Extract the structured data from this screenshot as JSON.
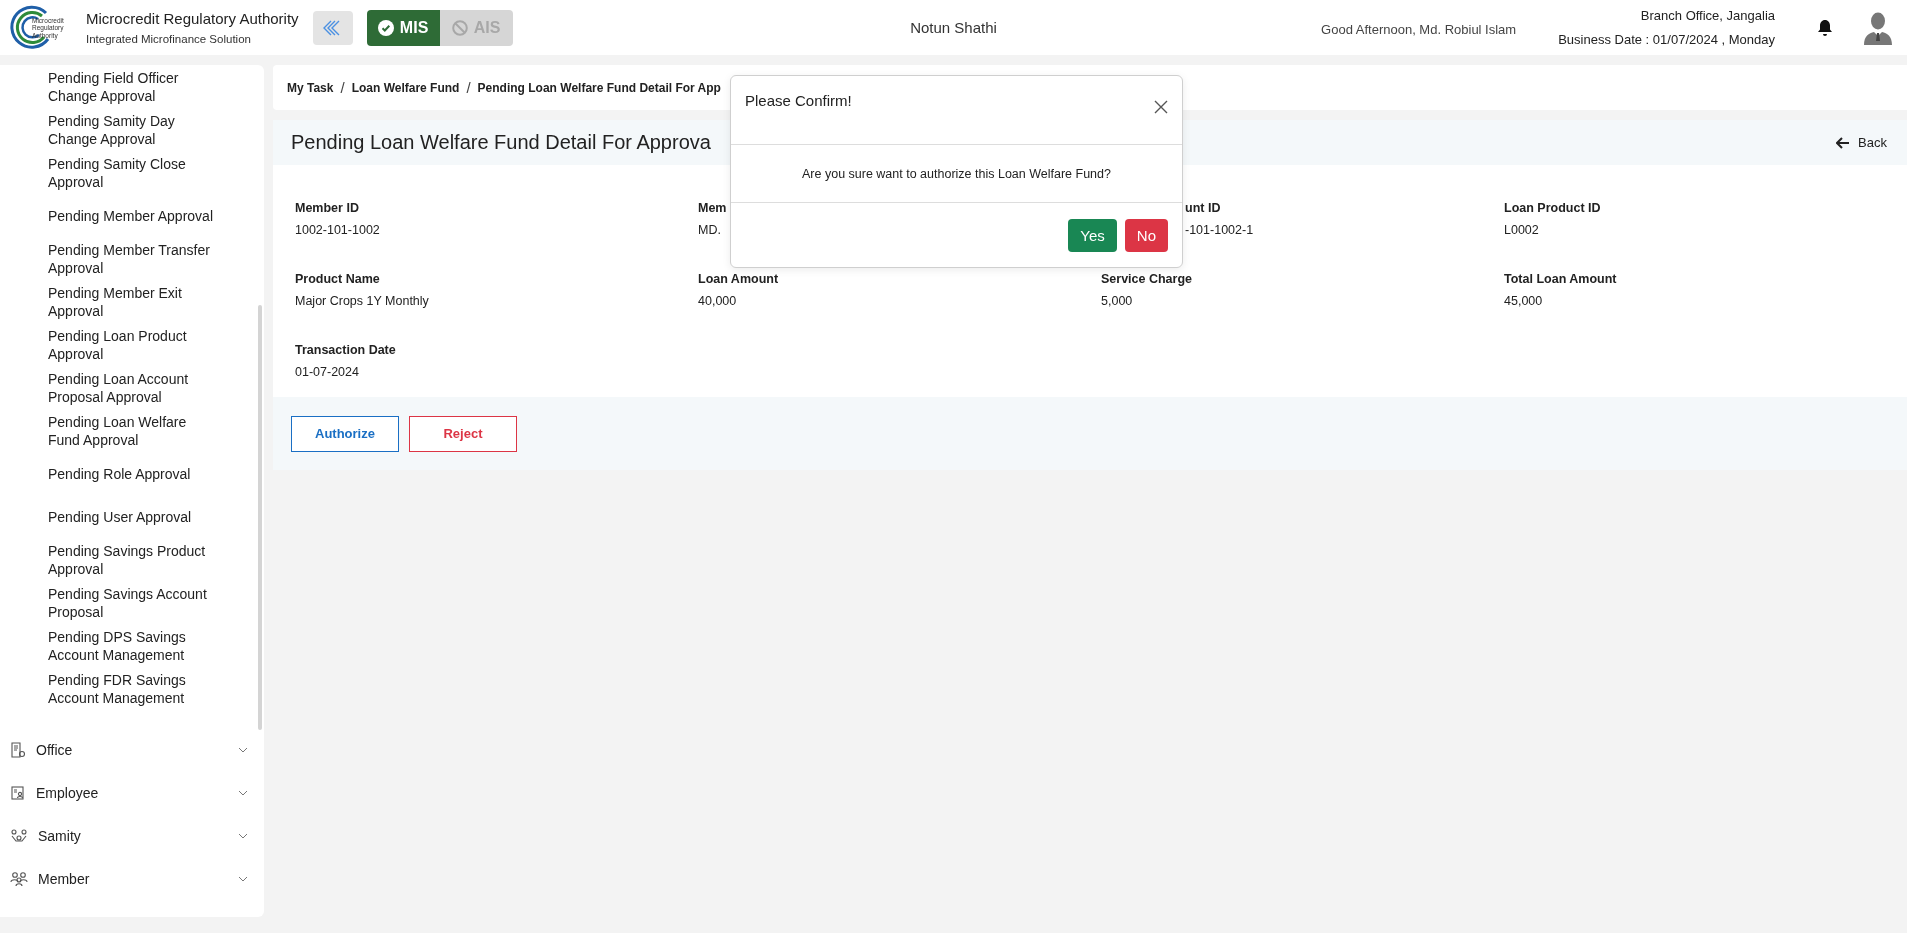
{
  "header": {
    "logo_text": "Microcredit Regulatory Authority",
    "org_title": "Microcredit Regulatory Authority",
    "org_subtitle": "Integrated Microfinance Solution",
    "modules": [
      {
        "label": "MIS",
        "selected": true
      },
      {
        "label": "AIS",
        "selected": false
      }
    ],
    "app_name": "Notun Shathi",
    "greeting": "Good Afternoon, Md. Robiul Islam",
    "branch": "Branch Office, Jangalia",
    "business_date": "Business Date : 01/07/2024 , Monday"
  },
  "sidebar": {
    "items": [
      {
        "label": "Pending Field Officer Change Approval"
      },
      {
        "label": "Pending Samity Day Change Approval"
      },
      {
        "label": "Pending Samity Close Approval"
      },
      {
        "label": "Pending Member Approval"
      },
      {
        "label": "Pending Member Transfer Approval"
      },
      {
        "label": "Pending Member Exit Approval"
      },
      {
        "label": "Pending Loan Product Approval"
      },
      {
        "label": "Pending Loan Account Proposal Approval"
      },
      {
        "label": "Pending Loan Welfare Fund Approval"
      },
      {
        "label": "Pending Role Approval"
      },
      {
        "label": "Pending User Approval"
      },
      {
        "label": "Pending Savings Product Approval"
      },
      {
        "label": "Pending Savings Account Proposal"
      },
      {
        "label": "Pending DPS Savings Account Management"
      },
      {
        "label": "Pending FDR Savings Account Management"
      }
    ],
    "menus": [
      {
        "label": "Office",
        "kind": "office",
        "expanded": false
      },
      {
        "label": "Employee",
        "kind": "employee",
        "expanded": false
      },
      {
        "label": "Samity",
        "kind": "samity",
        "expanded": false
      },
      {
        "label": "Member",
        "kind": "member",
        "expanded": false
      }
    ]
  },
  "breadcrumb": {
    "items": [
      "My Task",
      "Loan Welfare Fund",
      "Pending Loan Welfare Fund Detail For App"
    ],
    "separators": [
      "/",
      "/"
    ]
  },
  "page": {
    "title": "Pending Loan Welfare Fund Detail For Approva",
    "back_label": "Back"
  },
  "details": [
    {
      "label": "Member ID",
      "value": "1002-101-1002"
    },
    {
      "label": "Mem",
      "value": "MD."
    },
    {
      "label": "unt ID",
      "value": "-101-1002-1",
      "cut": true
    },
    {
      "label": "Loan Product ID",
      "value": "L0002"
    },
    {
      "label": "Product Name",
      "value": "Major Crops 1Y Monthly"
    },
    {
      "label": "Loan Amount",
      "value": "40,000"
    },
    {
      "label": "Service Charge",
      "value": "5,000"
    },
    {
      "label": "Total Loan Amount",
      "value": "45,000"
    },
    {
      "label": "Transaction Date",
      "value": "01-07-2024"
    }
  ],
  "actions": [
    {
      "label": "Authorize",
      "kind": "primary"
    },
    {
      "label": "Reject",
      "kind": "danger"
    }
  ],
  "dialog": {
    "title": "Please Confirm!",
    "message": "Are you sure want to authorize this Loan Welfare Fund?",
    "buttons": [
      {
        "label": "Yes",
        "kind": "confirm"
      },
      {
        "label": "No",
        "kind": "cancel"
      }
    ]
  }
}
